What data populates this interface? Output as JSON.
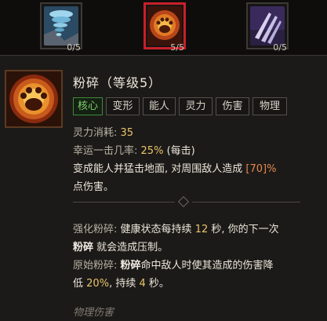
{
  "slots": [
    {
      "name": "tornado",
      "rank": "0/5",
      "selected": false
    },
    {
      "name": "pulverize",
      "rank": "5/5",
      "selected": true
    },
    {
      "name": "claw",
      "rank": "0/5",
      "selected": false
    }
  ],
  "skill": {
    "name": "粉碎（等级5）",
    "tags": [
      "核心",
      "变形",
      "能人",
      "灵力",
      "伤害",
      "物理"
    ],
    "cost_label": "灵力消耗:",
    "cost_value": "35",
    "lucky_label": "幸运一击几率:",
    "lucky_value": "25%",
    "lucky_suffix": "(每击)",
    "desc_1a": "变成能人并猛击地面, 对周围敌人造成",
    "desc_1b": "[70]%",
    "desc_2": "点伤害。",
    "enh_label": "强化粉碎:",
    "enh_a": "健康状态每持续",
    "enh_num": "12",
    "enh_b": "秒, 你的下一次",
    "enh_c_bold": "粉碎",
    "enh_c": "就会造成压制。",
    "prim_label": "原始粉碎:",
    "prim_bold": "粉碎",
    "prim_a": "命中敌人时使其造成的伤害降",
    "prim_b": "低",
    "prim_pct": "20%",
    "prim_c": ", 持续",
    "prim_num": "4",
    "prim_d": "秒。",
    "footer": "物理伤害"
  },
  "colors": {
    "core_tag": "#7fd06a",
    "value_yellow": "#e8c56a",
    "damage_orange": "#e48a4d",
    "selected_frame": "#c8202a"
  }
}
